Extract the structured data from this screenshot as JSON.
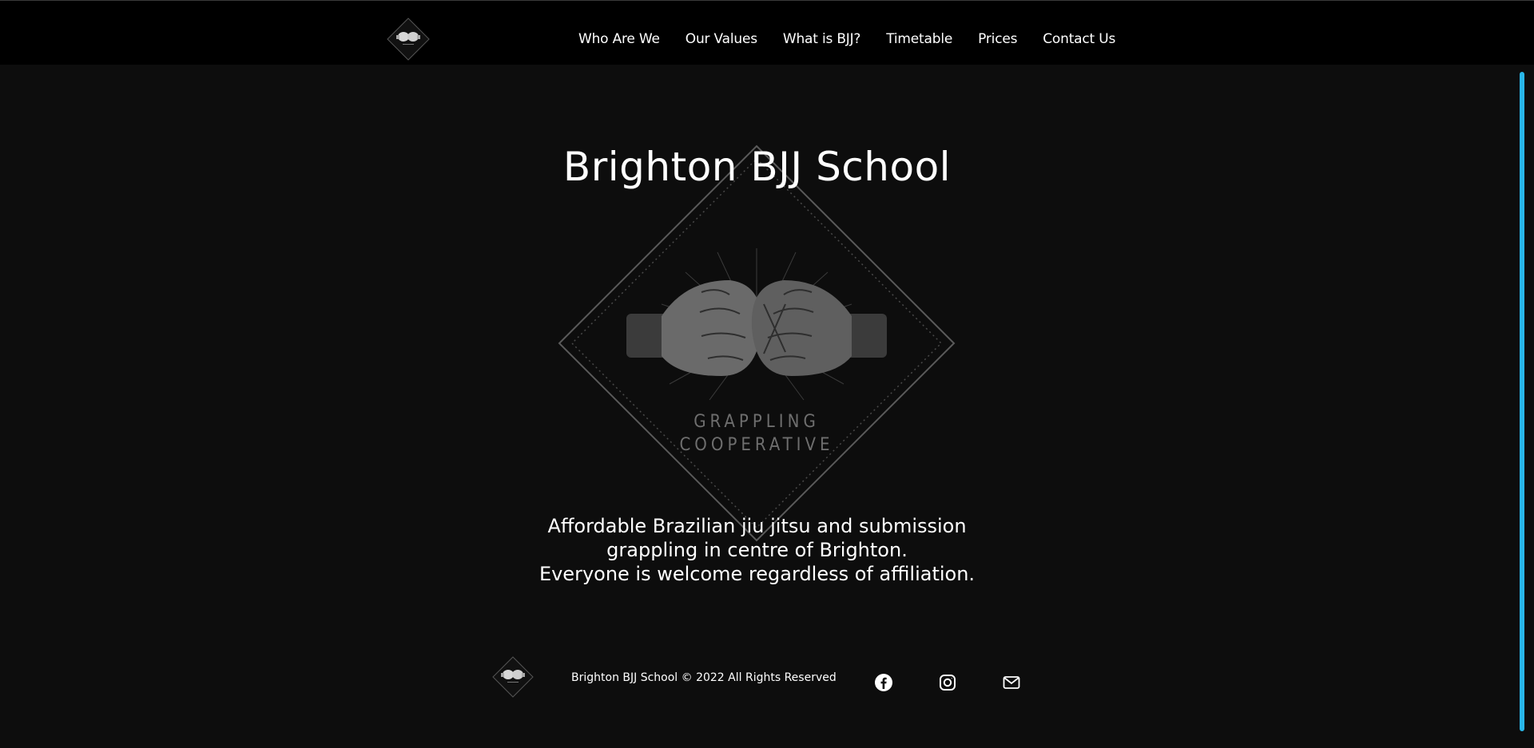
{
  "nav": {
    "items": [
      {
        "label": "Who Are We"
      },
      {
        "label": "Our Values"
      },
      {
        "label": "What is BJJ?"
      },
      {
        "label": "Timetable"
      },
      {
        "label": "Prices"
      },
      {
        "label": "Contact Us"
      }
    ],
    "logo_icon": "fists-diamond-logo"
  },
  "hero": {
    "title": "Brighton BJJ School",
    "emblem_text_line1": "GRAPPLING",
    "emblem_text_line2": "COOPERATIVE",
    "tagline_line1": "Affordable Brazilian jiu jitsu and submission",
    "tagline_line2": "grappling in centre of Brighton.",
    "tagline_line3": "Everyone is welcome regardless of affiliation."
  },
  "footer": {
    "copyright": "Brighton BJJ School © 2022 All Rights Reserved",
    "social": [
      {
        "icon": "facebook-icon"
      },
      {
        "icon": "instagram-icon"
      },
      {
        "icon": "mail-icon"
      }
    ]
  },
  "colors": {
    "background": "#0d0d0d",
    "navbar": "#000000",
    "text": "#ffffff",
    "scrollbar": "#29b6e8"
  }
}
